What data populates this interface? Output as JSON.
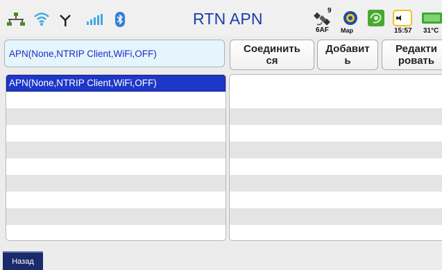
{
  "status_bar": {
    "title": "RTN APN",
    "satellite_count": "9",
    "satellite_label": "6AF",
    "map_label": "Map",
    "time": "15:57",
    "temperature": "31°C",
    "icons": [
      "network-icon",
      "wifi-icon",
      "antenna-icon",
      "signal-bars-icon",
      "bluetooth-icon",
      "satellite-icon",
      "map-icon",
      "gps-icon",
      "volume-icon",
      "battery-icon"
    ]
  },
  "apn_selector": {
    "value": "APN(None,NTRIP Client,WiFi,OFF)"
  },
  "buttons": {
    "connect": "Соединить\nся",
    "add": "Добавит\nь",
    "edit": "Редакти\nровать"
  },
  "apn_list": {
    "items": [
      "APN(None,NTRIP Client,WiFi,OFF)"
    ],
    "selected_index": 0
  },
  "back_button": {
    "label": "Назад"
  },
  "colors": {
    "accent": "#1f37c9",
    "title": "#1a3ea8",
    "selector_bg": "#e6f4fb"
  }
}
